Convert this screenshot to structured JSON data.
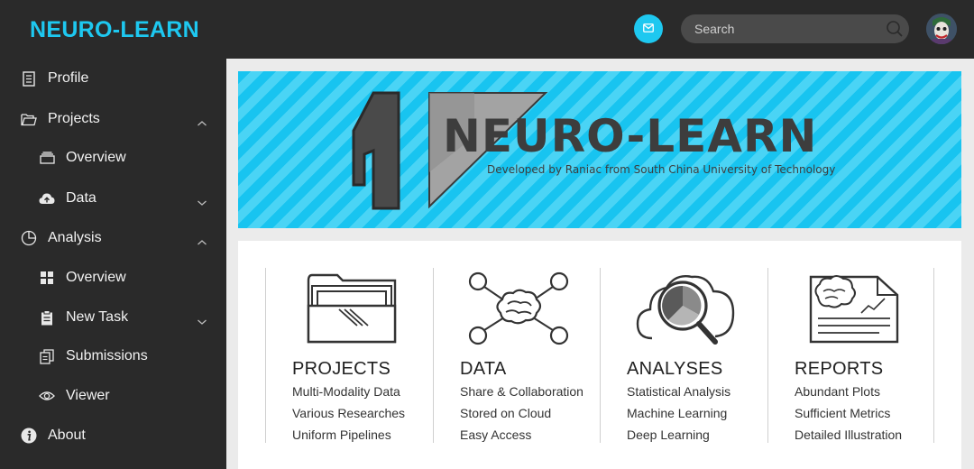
{
  "brand": "NEURO-LEARN",
  "header": {
    "search_placeholder": "Search",
    "mail_icon": "mail-icon",
    "search_icon": "search-icon",
    "avatar": "user-avatar"
  },
  "colors": {
    "accent": "#1ec8f0",
    "sidebar_bg": "#2a2a2a",
    "text_light": "#f2f2f2"
  },
  "sidebar": {
    "items": [
      {
        "label": "Profile",
        "icon": "document-icon"
      },
      {
        "label": "Projects",
        "icon": "folder-open-icon",
        "chevron": "up"
      },
      {
        "label": "Overview",
        "icon": "box-icon"
      },
      {
        "label": "Data",
        "icon": "cloud-upload-icon",
        "chevron": "down"
      },
      {
        "label": "Analysis",
        "icon": "pie-chart-icon",
        "chevron": "up"
      },
      {
        "label": "Overview",
        "icon": "grid-icon"
      },
      {
        "label": "New Task",
        "icon": "clipboard-icon",
        "chevron": "down"
      },
      {
        "label": "Submissions",
        "icon": "copy-icon"
      },
      {
        "label": "Viewer",
        "icon": "eye-icon"
      },
      {
        "label": "About",
        "icon": "info-icon"
      }
    ]
  },
  "banner": {
    "title": "NEURO-LEARN",
    "subtitle": "Developed by Raniac from South China University of Technology"
  },
  "features": [
    {
      "title": "PROJECTS",
      "icon": "folder-icon",
      "lines": [
        "Multi-Modality Data",
        "Various Researches",
        "Uniform Pipelines"
      ]
    },
    {
      "title": "DATA",
      "icon": "brain-network-icon",
      "lines": [
        "Share & Collaboration",
        "Stored on Cloud",
        "Easy Access"
      ]
    },
    {
      "title": "ANALYSES",
      "icon": "cloud-magnifier-icon",
      "lines": [
        "Statistical Analysis",
        "Machine Learning",
        "Deep Learning"
      ]
    },
    {
      "title": "REPORTS",
      "icon": "report-document-icon",
      "lines": [
        "Abundant Plots",
        "Sufficient Metrics",
        "Detailed Illustration"
      ]
    }
  ]
}
